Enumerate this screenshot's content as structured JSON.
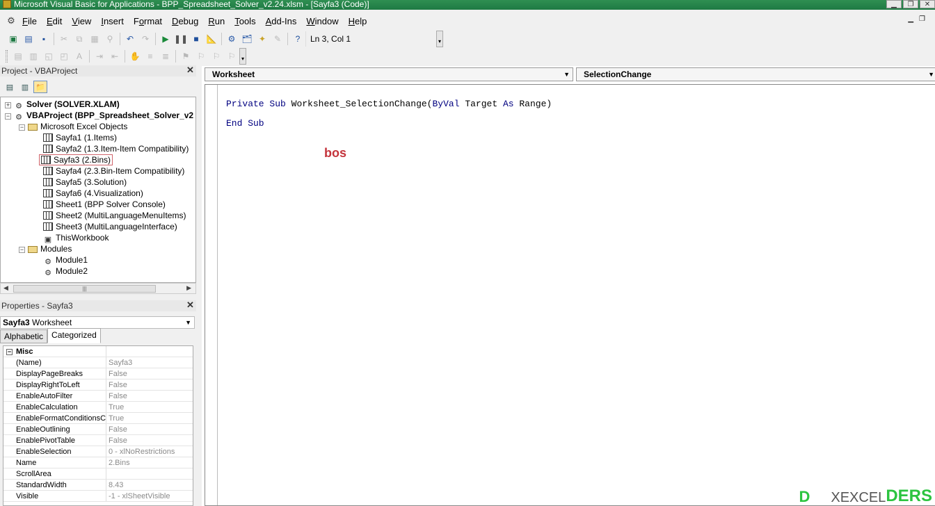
{
  "window": {
    "title": "Microsoft Visual Basic for Applications - BPP_Spreadsheet_Solver_v2.24.xlsm - [Sayfa3 (Code)]"
  },
  "menu": {
    "items": [
      {
        "label": "File",
        "key": "F"
      },
      {
        "label": "Edit",
        "key": "E"
      },
      {
        "label": "View",
        "key": "V"
      },
      {
        "label": "Insert",
        "key": "I"
      },
      {
        "label": "Format",
        "key": "o"
      },
      {
        "label": "Debug",
        "key": "D"
      },
      {
        "label": "Run",
        "key": "R"
      },
      {
        "label": "Tools",
        "key": "T"
      },
      {
        "label": "Add-Ins",
        "key": "A"
      },
      {
        "label": "Window",
        "key": "W"
      },
      {
        "label": "Help",
        "key": "H"
      }
    ]
  },
  "toolbar": {
    "position_readout": "Ln 3, Col 1"
  },
  "project_explorer": {
    "title": "Project - VBAProject",
    "nodes": {
      "solver": "Solver (SOLVER.XLAM)",
      "vbaproject": "VBAProject (BPP_Spreadsheet_Solver_v2",
      "excel_objects": "Microsoft Excel Objects",
      "sayfa1": "Sayfa1 (1.Items)",
      "sayfa2": "Sayfa2 (1.3.Item-Item Compatibility)",
      "sayfa3": "Sayfa3 (2.Bins)",
      "sayfa4": "Sayfa4 (2.3.Bin-Item Compatibility)",
      "sayfa5": "Sayfa5 (3.Solution)",
      "sayfa6": "Sayfa6 (4.Visualization)",
      "sheet1": "Sheet1 (BPP Solver Console)",
      "sheet2": "Sheet2 (MultiLanguageMenuItems)",
      "sheet3": "Sheet3 (MultiLanguageInterface)",
      "thisworkbook": "ThisWorkbook",
      "modules": "Modules",
      "module1": "Module1",
      "module2": "Module2"
    }
  },
  "properties": {
    "title": "Properties - Sayfa3",
    "object_name": "Sayfa3",
    "object_type": "Worksheet",
    "tabs": {
      "alphabetic": "Alphabetic",
      "categorized": "Categorized"
    },
    "category": "Misc",
    "rows": [
      {
        "name": "(Name)",
        "value": "Sayfa3"
      },
      {
        "name": "DisplayPageBreaks",
        "value": "False"
      },
      {
        "name": "DisplayRightToLeft",
        "value": "False"
      },
      {
        "name": "EnableAutoFilter",
        "value": "False"
      },
      {
        "name": "EnableCalculation",
        "value": "True"
      },
      {
        "name": "EnableFormatConditionsCa",
        "value": "True"
      },
      {
        "name": "EnableOutlining",
        "value": "False"
      },
      {
        "name": "EnablePivotTable",
        "value": "False"
      },
      {
        "name": "EnableSelection",
        "value": "0 - xlNoRestrictions"
      },
      {
        "name": "Name",
        "value": "2.Bins"
      },
      {
        "name": "ScrollArea",
        "value": ""
      },
      {
        "name": "StandardWidth",
        "value": "8.43"
      },
      {
        "name": "Visible",
        "value": "-1 - xlSheetVisible"
      }
    ]
  },
  "code_window": {
    "object_combo": "Worksheet",
    "procedure_combo": "SelectionChange",
    "line1_kw1": "Private Sub",
    "line1_name": "Worksheet_SelectionChange(",
    "line1_kw2": "ByVal",
    "line1_arg": "Target",
    "line1_kw3": "As",
    "line1_type": "Range)",
    "line2": "End Sub",
    "annotation": "bos"
  },
  "watermark": {
    "left": "D",
    "middle": "XEXCEL",
    "right": "DERS"
  },
  "colors": {
    "titlebar": "#1e7a43",
    "annotation": "#c4343c",
    "watermark": "#2cc440"
  }
}
